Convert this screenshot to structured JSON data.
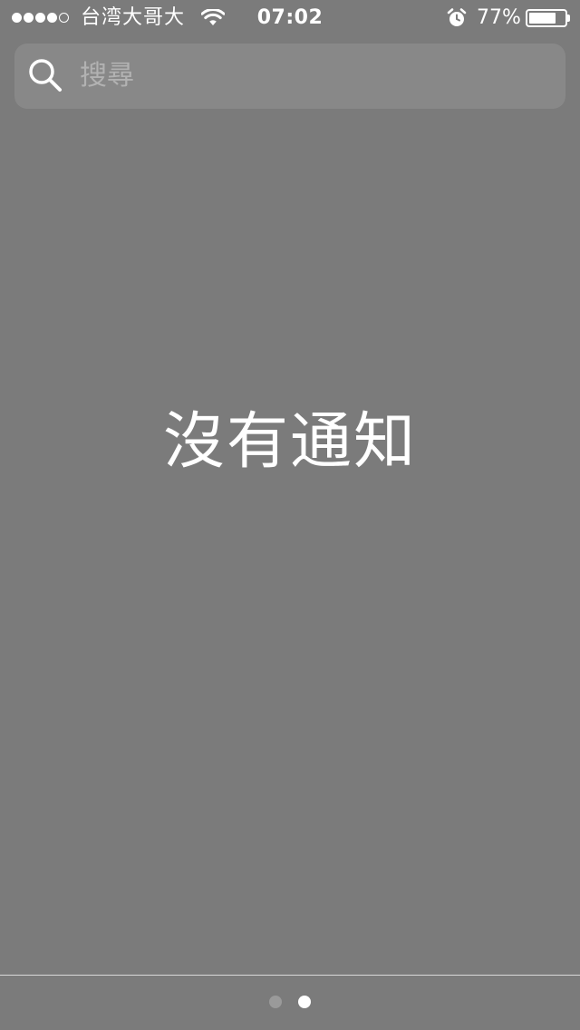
{
  "status_bar": {
    "signal_bars": {
      "filled": 4,
      "total": 5
    },
    "carrier": "台湾大哥大",
    "wifi_icon": "wifi-icon",
    "time": "07:02",
    "alarm_icon": "alarm-clock-icon",
    "battery_percent_text": "77%",
    "battery_level": 0.77
  },
  "search": {
    "placeholder": "搜尋",
    "value": "",
    "icon": "search-icon"
  },
  "notification_center": {
    "empty_message": "沒有通知"
  },
  "pager": {
    "count": 2,
    "current": 2
  },
  "colors": {
    "background": "#7b7b7b",
    "search_bar": "#888888",
    "text": "#ffffff",
    "placeholder": "#b2b2b2",
    "inactive_dot": "#9a9a9a"
  }
}
